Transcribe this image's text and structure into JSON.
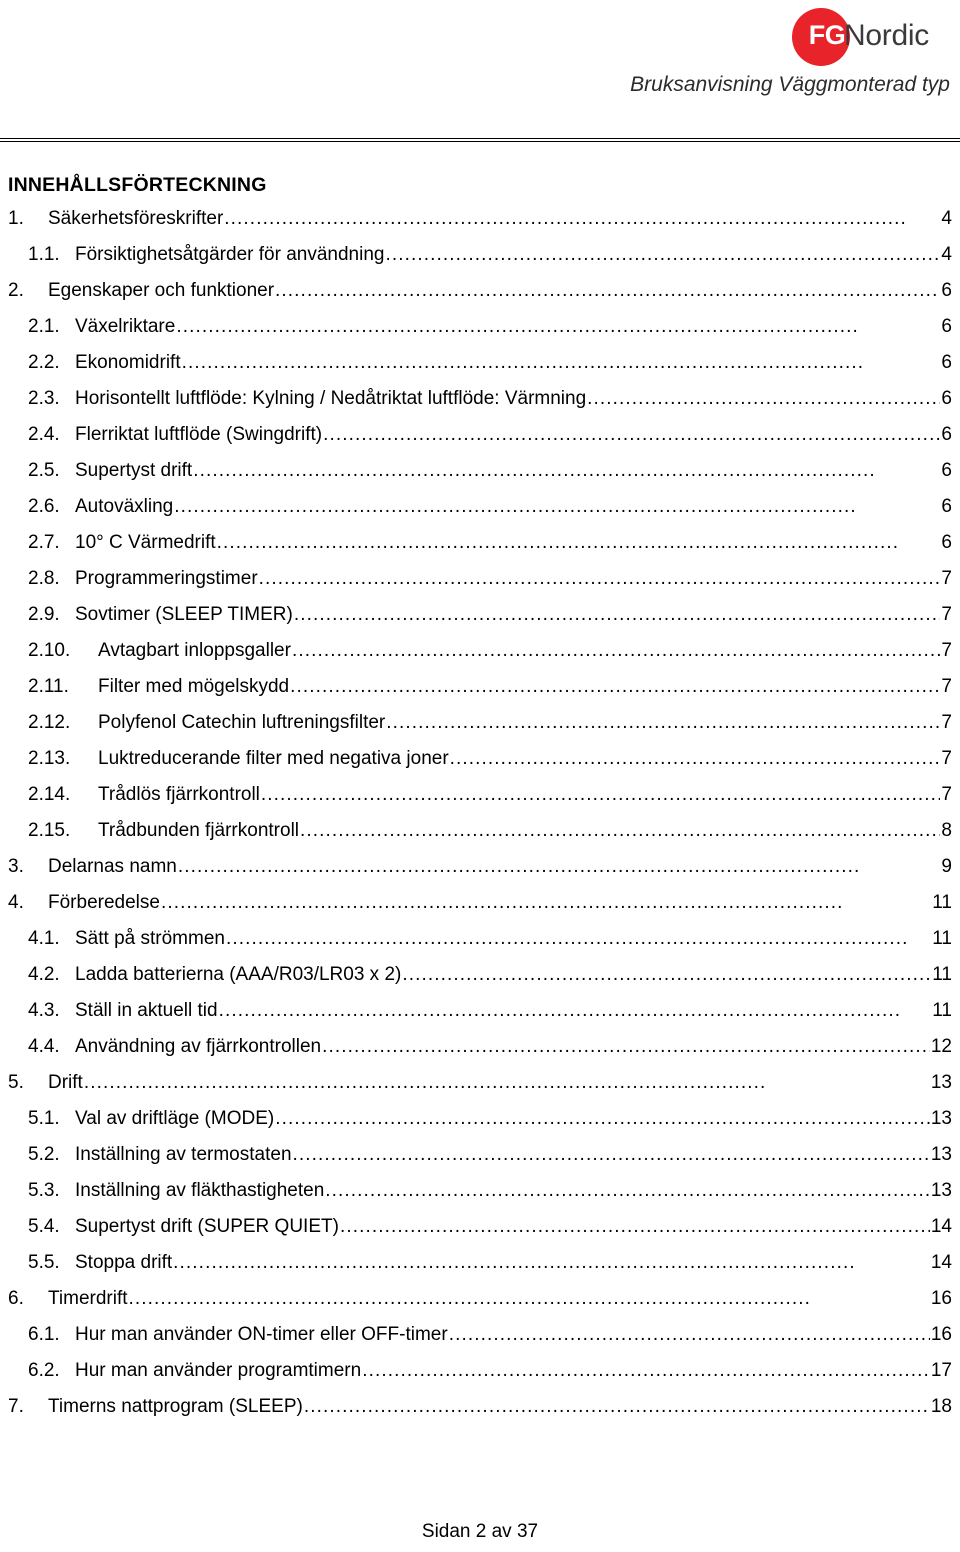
{
  "header": {
    "logo": {
      "badge_text": "FG",
      "word_text": "Nordic",
      "badge_color": "#e8242a",
      "word_color": "#3a3a3c"
    },
    "subtitle": "Bruksanvisning Väggmonterad typ"
  },
  "toc": {
    "title": "INNEHÅLLSFÖRTECKNING",
    "leader_dots": "...........................................................................................................",
    "entries": [
      {
        "num": "1.",
        "label": "Säkerhetsföreskrifter",
        "page": "4",
        "level": 1
      },
      {
        "num": "1.1.",
        "label": "Försiktighetsåtgärder för användning",
        "page": "4",
        "level": 2
      },
      {
        "num": "2.",
        "label": "Egenskaper och funktioner",
        "page": "6",
        "level": 1
      },
      {
        "num": "2.1.",
        "label": "Växelriktare",
        "page": "6",
        "level": 2
      },
      {
        "num": "2.2.",
        "label": "Ekonomidrift",
        "page": "6",
        "level": 2
      },
      {
        "num": "2.3.",
        "label": "Horisontellt luftflöde: Kylning / Nedåtriktat luftflöde: Värmning",
        "page": "6",
        "level": 2
      },
      {
        "num": "2.4.",
        "label": "Flerriktat luftflöde (Swingdrift)",
        "page": "6",
        "level": 2
      },
      {
        "num": "2.5.",
        "label": "Supertyst drift",
        "page": "6",
        "level": 2
      },
      {
        "num": "2.6.",
        "label": "Autoväxling",
        "page": "6",
        "level": 2
      },
      {
        "num": "2.7.",
        "label": "10° C Värmedrift",
        "page": "6",
        "level": 2
      },
      {
        "num": "2.8.",
        "label": "Programmeringstimer",
        "page": "7",
        "level": 2
      },
      {
        "num": "2.9.",
        "label": "Sovtimer (SLEEP TIMER)",
        "page": "7",
        "level": 2
      },
      {
        "num": "2.10.",
        "label": "Avtagbart inloppsgaller",
        "page": "7",
        "level": 3
      },
      {
        "num": "2.11.",
        "label": "Filter med mögelskydd",
        "page": "7",
        "level": 3
      },
      {
        "num": "2.12.",
        "label": "Polyfenol Catechin luftreningsfilter",
        "page": "7",
        "level": 3
      },
      {
        "num": "2.13.",
        "label": "Luktreducerande filter med negativa joner",
        "page": "7",
        "level": 3
      },
      {
        "num": "2.14.",
        "label": "Trådlös fjärrkontroll",
        "page": "7",
        "level": 3
      },
      {
        "num": "2.15.",
        "label": "Trådbunden fjärrkontroll",
        "page": "8",
        "level": 3
      },
      {
        "num": "3.",
        "label": "Delarnas namn",
        "page": "9",
        "level": 1
      },
      {
        "num": "4.",
        "label": "Förberedelse",
        "page": "11",
        "level": 1
      },
      {
        "num": "4.1.",
        "label": "Sätt på strömmen",
        "page": "11",
        "level": 2
      },
      {
        "num": "4.2.",
        "label": "Ladda batterierna (AAA/R03/LR03 x 2)",
        "page": "11",
        "level": 2
      },
      {
        "num": "4.3.",
        "label": "Ställ in aktuell tid",
        "page": "11",
        "level": 2
      },
      {
        "num": "4.4.",
        "label": "Användning av fjärrkontrollen",
        "page": "12",
        "level": 2
      },
      {
        "num": "5.",
        "label": "Drift",
        "page": "13",
        "level": 1
      },
      {
        "num": "5.1.",
        "label": "Val av driftläge (MODE)",
        "page": "13",
        "level": 2
      },
      {
        "num": "5.2.",
        "label": "Inställning av termostaten",
        "page": "13",
        "level": 2
      },
      {
        "num": "5.3.",
        "label": "Inställning av fläkthastigheten",
        "page": "13",
        "level": 2
      },
      {
        "num": "5.4.",
        "label": "Supertyst drift (SUPER QUIET)",
        "page": "14",
        "level": 2
      },
      {
        "num": "5.5.",
        "label": "Stoppa drift",
        "page": "14",
        "level": 2
      },
      {
        "num": "6.",
        "label": "Timerdrift",
        "page": "16",
        "level": 1
      },
      {
        "num": "6.1.",
        "label": "Hur man använder ON-timer eller OFF-timer",
        "page": "16",
        "level": 2
      },
      {
        "num": "6.2.",
        "label": "Hur man använder programtimern",
        "page": "17",
        "level": 2
      },
      {
        "num": "7.",
        "label": "Timerns nattprogram (SLEEP)",
        "page": "18",
        "level": 1
      }
    ]
  },
  "footer": {
    "page_label": "Sidan 2 av 37"
  }
}
